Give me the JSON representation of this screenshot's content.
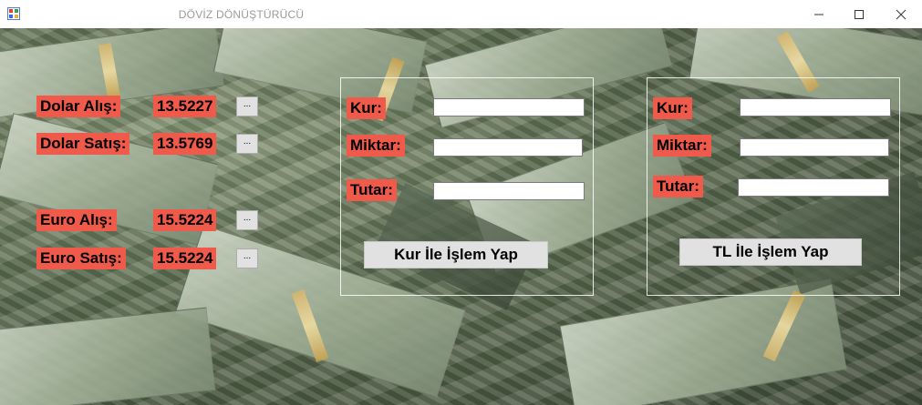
{
  "window": {
    "title": "DÖVİZ DÖNÜŞTÜRÜCÜ",
    "minimize_glyph": "—",
    "maximize_glyph": "☐",
    "close_glyph": "✕"
  },
  "rates": {
    "dollar_buy_label": "Dolar Alış:",
    "dollar_buy_value": "13.5227",
    "dollar_sell_label": "Dolar Satış:",
    "dollar_sell_value": "13.5769",
    "euro_buy_label": "Euro Alış:",
    "euro_buy_value": "15.5224",
    "euro_sell_label": "Euro Satış:",
    "euro_sell_value": "15.5224",
    "ellipsis_label": "..."
  },
  "kur_panel": {
    "kur_label": "Kur:",
    "miktar_label": "Miktar:",
    "tutar_label": "Tutar:",
    "kur_value": "",
    "miktar_value": "",
    "tutar_value": "",
    "button_label": "Kur İle İşlem Yap"
  },
  "tl_panel": {
    "kur_label": "Kur:",
    "miktar_label": "Miktar:",
    "tutar_label": "Tutar:",
    "kur_value": "",
    "miktar_value": "",
    "tutar_value": "",
    "button_label": "TL İle İşlem Yap"
  },
  "colors": {
    "label_bg": "#f05a4a",
    "button_bg": "#e1e1e1"
  },
  "icons": {
    "app": "app-icon",
    "minimize": "minimize-icon",
    "maximize": "maximize-icon",
    "close": "close-icon"
  }
}
